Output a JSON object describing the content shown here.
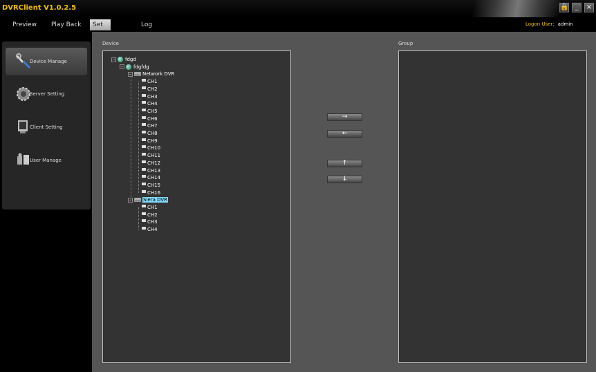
{
  "app": {
    "title": "DVRClient V1.0.2.5"
  },
  "window_controls": {
    "lock": "🔒",
    "minimize": "_",
    "close": "×"
  },
  "menu": {
    "preview": "Preview",
    "playback": "Play Back",
    "set": "Set",
    "log": "Log"
  },
  "logon": {
    "label": "Logon User:",
    "user": "admin"
  },
  "sidebar": {
    "items": [
      {
        "label": "Device Manage",
        "icon": "wrench-icon",
        "active": true
      },
      {
        "label": "Server Setting",
        "icon": "gear-icon"
      },
      {
        "label": "Client Setting",
        "icon": "monitor-icon"
      },
      {
        "label": "User Manage",
        "icon": "users-icon"
      }
    ]
  },
  "device_panel": {
    "label": "Device"
  },
  "group_panel": {
    "label": "Group"
  },
  "buttons": {
    "right": "→",
    "left": "←",
    "up": "↑",
    "down": "↓"
  },
  "tree": {
    "root": "fdgd",
    "area": "fdgfdg",
    "dvr1": {
      "name": "Network DVR",
      "channels": [
        "CH1",
        "CH2",
        "CH3",
        "CH4",
        "CH5",
        "CH6",
        "CH7",
        "CH8",
        "CH9",
        "CH10",
        "CH11",
        "CH12",
        "CH13",
        "CH14",
        "CH15",
        "CH16"
      ]
    },
    "dvr2": {
      "name": "Siera DVR",
      "selected": true,
      "channels": [
        "CH1",
        "CH2",
        "CH3",
        "CH4"
      ]
    }
  },
  "expander": {
    "minus": "−"
  },
  "colors": {
    "accent": "#f0c000",
    "selection": "#7fd8ff",
    "panel": "#333333"
  }
}
